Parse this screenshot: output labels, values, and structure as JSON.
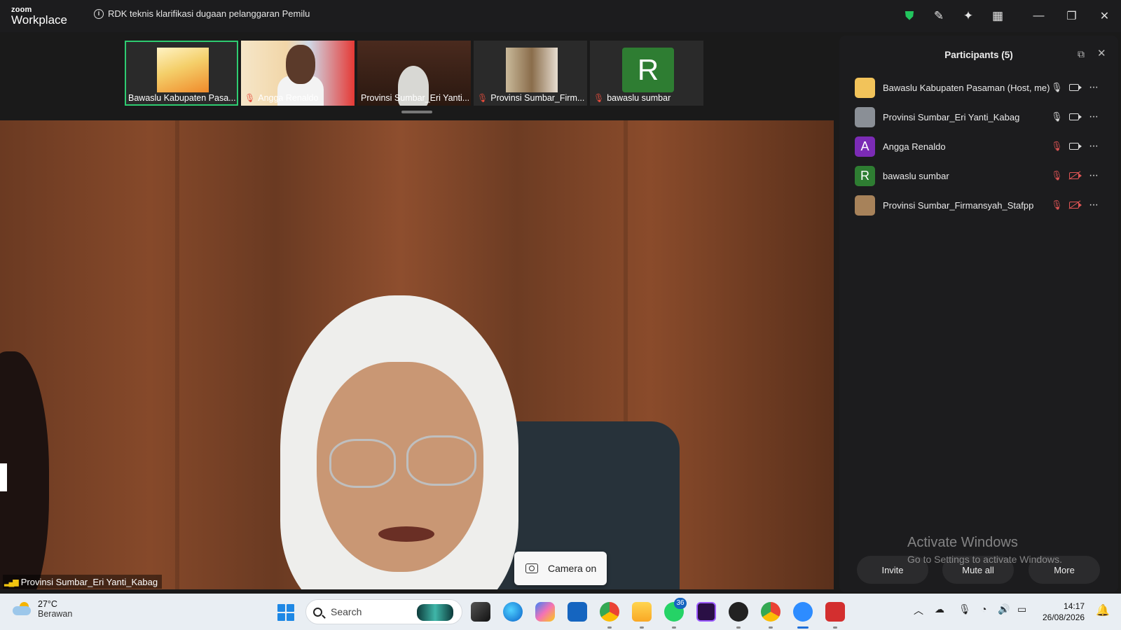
{
  "app": {
    "logo_small": "zoom",
    "logo_big": "Workplace",
    "meeting_title": "RDK teknis klarifikasi dugaan pelanggaran Pemilu"
  },
  "titlebar": {
    "icons": [
      "shield-check-icon",
      "annotate-icon",
      "ai-sparkle-icon",
      "apps-grid-icon"
    ],
    "window_controls": [
      "minimize",
      "restore",
      "close"
    ]
  },
  "thumbnails": [
    {
      "name": "Bawaslu Kabupaten Pasa...",
      "muted": false,
      "active": true
    },
    {
      "name": "Angga Renaldo",
      "muted": true,
      "active": false
    },
    {
      "name": "Provinsi Sumbar_Eri Yanti...",
      "muted": false,
      "active": false
    },
    {
      "name": "Provinsi Sumbar_Firm...",
      "muted": true,
      "active": false
    },
    {
      "name": "bawaslu sumbar",
      "muted": true,
      "active": false,
      "avatar_letter": "R",
      "avatar_color": "#2e7d32"
    }
  ],
  "main_video": {
    "speaker": "Provinsi Sumbar_Eri Yanti_Kabag",
    "camera_toast": "Camera on"
  },
  "participants": {
    "title": "Participants (5)",
    "list": [
      {
        "name": "Bawaslu Kabupaten Pasaman (Host, me)",
        "mic": "on",
        "cam": "on",
        "avatar_color": "#f2c35a"
      },
      {
        "name": "Provinsi Sumbar_Eri Yanti_Kabag",
        "mic": "on",
        "cam": "on",
        "avatar_color": "#8a8f96"
      },
      {
        "name": "Angga Renaldo",
        "mic": "muted",
        "cam": "on",
        "avatar_letter": "A",
        "avatar_color": "#7b2bb5"
      },
      {
        "name": "bawaslu sumbar",
        "mic": "muted",
        "cam": "off",
        "avatar_letter": "R",
        "avatar_color": "#2e7d32"
      },
      {
        "name": "Provinsi Sumbar_Firmansyah_Stafpp",
        "mic": "muted",
        "cam": "off",
        "avatar_color": "#a7825a"
      }
    ],
    "buttons": {
      "invite": "Invite",
      "mute_all": "Mute all",
      "more": "More"
    }
  },
  "watermark": {
    "line1": "Activate Windows",
    "line2": "Go to Settings to activate Windows."
  },
  "taskbar": {
    "weather_temp": "27°C",
    "weather_desc": "Berawan",
    "search_placeholder": "Search",
    "whatsapp_badge": "36",
    "time": "14:17",
    "date": "26/08/2026"
  }
}
